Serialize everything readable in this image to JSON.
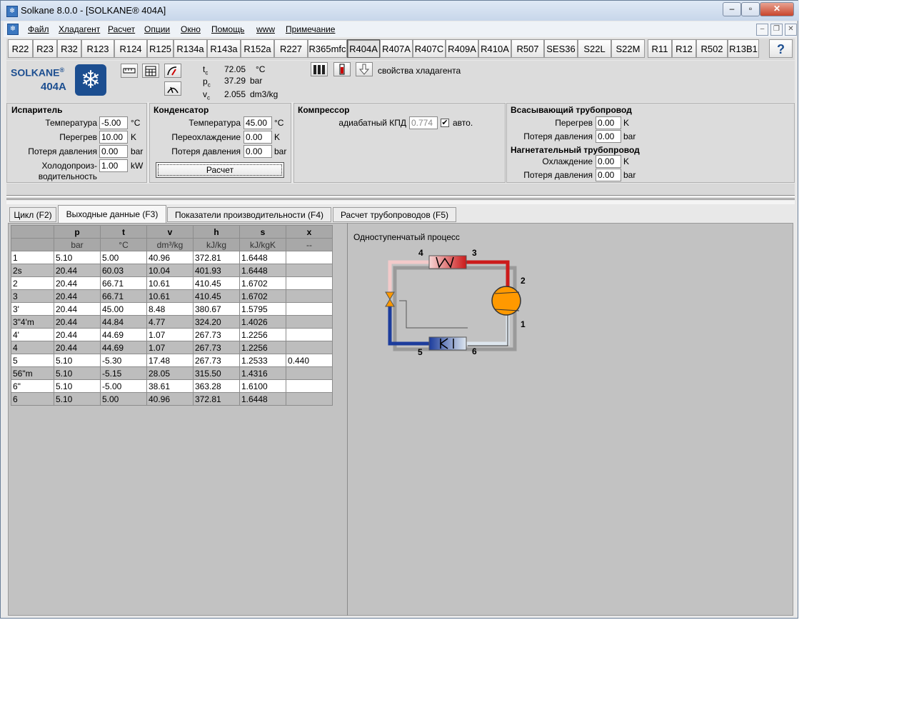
{
  "window": {
    "title": "Solkane 8.0.0 - [SOLKANE® 404A]"
  },
  "menu": [
    "Файл",
    "Хладагент",
    "Расчет",
    "Опции",
    "Окно",
    "Помощь",
    "www",
    "Примечание"
  ],
  "refrigerants": [
    "R22",
    "R23",
    "R32",
    "R123",
    "R124",
    "R125",
    "R134a",
    "R143a",
    "R152a",
    "R227",
    "R365mfc",
    "R404A",
    "R407A",
    "R407C",
    "R409A",
    "R410A",
    "R507",
    "SES36",
    "S22L",
    "S22M",
    "R11",
    "R12",
    "R502",
    "R13B1"
  ],
  "active_refrigerant": "R404A",
  "help_label": "?",
  "logo": {
    "brand": "SOLKANE",
    "reg": "®",
    "model": "404A"
  },
  "critical": [
    {
      "sym": "t",
      "sub": "c",
      "value": "72.05",
      "unit": "°C"
    },
    {
      "sym": "p",
      "sub": "c",
      "value": "37.29",
      "unit": "bar"
    },
    {
      "sym": "v",
      "sub": "c",
      "value": "2.055",
      "unit": "dm3/kg"
    }
  ],
  "props_label": "свойства хладагента",
  "evaporator": {
    "title": "Испаритель",
    "temperature": {
      "label": "Температура",
      "value": "-5.00",
      "unit": "°C"
    },
    "superheat": {
      "label": "Перегрев",
      "value": "10.00",
      "unit": "K"
    },
    "pressure_loss": {
      "label": "Потеря давления",
      "value": "0.00",
      "unit": "bar"
    },
    "capacity": {
      "label1": "Холодопроиз-",
      "label2": "водительность",
      "value": "1.00",
      "unit": "kW"
    }
  },
  "condenser": {
    "title": "Конденсатор",
    "temperature": {
      "label": "Температура",
      "value": "45.00",
      "unit": "°C"
    },
    "subcooling": {
      "label": "Переохлаждение",
      "value": "0.00",
      "unit": "K"
    },
    "pressure_loss": {
      "label": "Потеря давления",
      "value": "0.00",
      "unit": "bar"
    },
    "calc_label": "Расчет"
  },
  "compressor": {
    "title": "Компрессор",
    "efficiency": {
      "label": "адиабатный КПД",
      "value": "0.774",
      "auto_label": "авто.",
      "auto_checked": true
    }
  },
  "suction": {
    "title": "Всасывающий трубопровод",
    "superheat": {
      "label": "Перегрев",
      "value": "0.00",
      "unit": "K"
    },
    "pressure_loss": {
      "label": "Потеря давления",
      "value": "0.00",
      "unit": "bar"
    }
  },
  "discharge": {
    "title": "Нагнетательный трубопровод",
    "cooling": {
      "label": "Охлаждение",
      "value": "0.00",
      "unit": "K"
    },
    "pressure_loss": {
      "label": "Потеря давления",
      "value": "0.00",
      "unit": "bar"
    }
  },
  "tabs": [
    "Цикл (F2)",
    "Выходные данные (F3)",
    "Показатели производительности (F4)",
    "Расчет трубопроводов (F5)"
  ],
  "active_tab": 1,
  "table": {
    "columns": [
      "",
      "p",
      "t",
      "v",
      "h",
      "s",
      "x"
    ],
    "units": [
      "",
      "bar",
      "°C",
      "dm³/kg",
      "kJ/kg",
      "kJ/kgK",
      "--"
    ],
    "rows": [
      [
        "1",
        "5.10",
        "5.00",
        "40.96",
        "372.81",
        "1.6448",
        ""
      ],
      [
        "2s",
        "20.44",
        "60.03",
        "10.04",
        "401.93",
        "1.6448",
        ""
      ],
      [
        "2",
        "20.44",
        "66.71",
        "10.61",
        "410.45",
        "1.6702",
        ""
      ],
      [
        "3",
        "20.44",
        "66.71",
        "10.61",
        "410.45",
        "1.6702",
        ""
      ],
      [
        "3'",
        "20.44",
        "45.00",
        "8.48",
        "380.67",
        "1.5795",
        ""
      ],
      [
        "3\"4'm",
        "20.44",
        "44.84",
        "4.77",
        "324.20",
        "1.4026",
        ""
      ],
      [
        "4'",
        "20.44",
        "44.69",
        "1.07",
        "267.73",
        "1.2256",
        ""
      ],
      [
        "4",
        "20.44",
        "44.69",
        "1.07",
        "267.73",
        "1.2256",
        ""
      ],
      [
        "5",
        "5.10",
        "-5.30",
        "17.48",
        "267.73",
        "1.2533",
        "0.440"
      ],
      [
        "56\"m",
        "5.10",
        "-5.15",
        "28.05",
        "315.50",
        "1.4316",
        ""
      ],
      [
        "6\"",
        "5.10",
        "-5.00",
        "38.61",
        "363.28",
        "1.6100",
        ""
      ],
      [
        "6",
        "5.10",
        "5.00",
        "40.96",
        "372.81",
        "1.6448",
        ""
      ]
    ]
  },
  "diagram": {
    "title": "Одноступенчатый процесс",
    "labels": [
      "1",
      "2",
      "3",
      "4",
      "5",
      "6"
    ],
    "colors": {
      "hot": "#cc1a1a",
      "cold": "#1c3c9c",
      "compressor": "#ff9900",
      "pipe_light": "#dde6ee"
    }
  }
}
